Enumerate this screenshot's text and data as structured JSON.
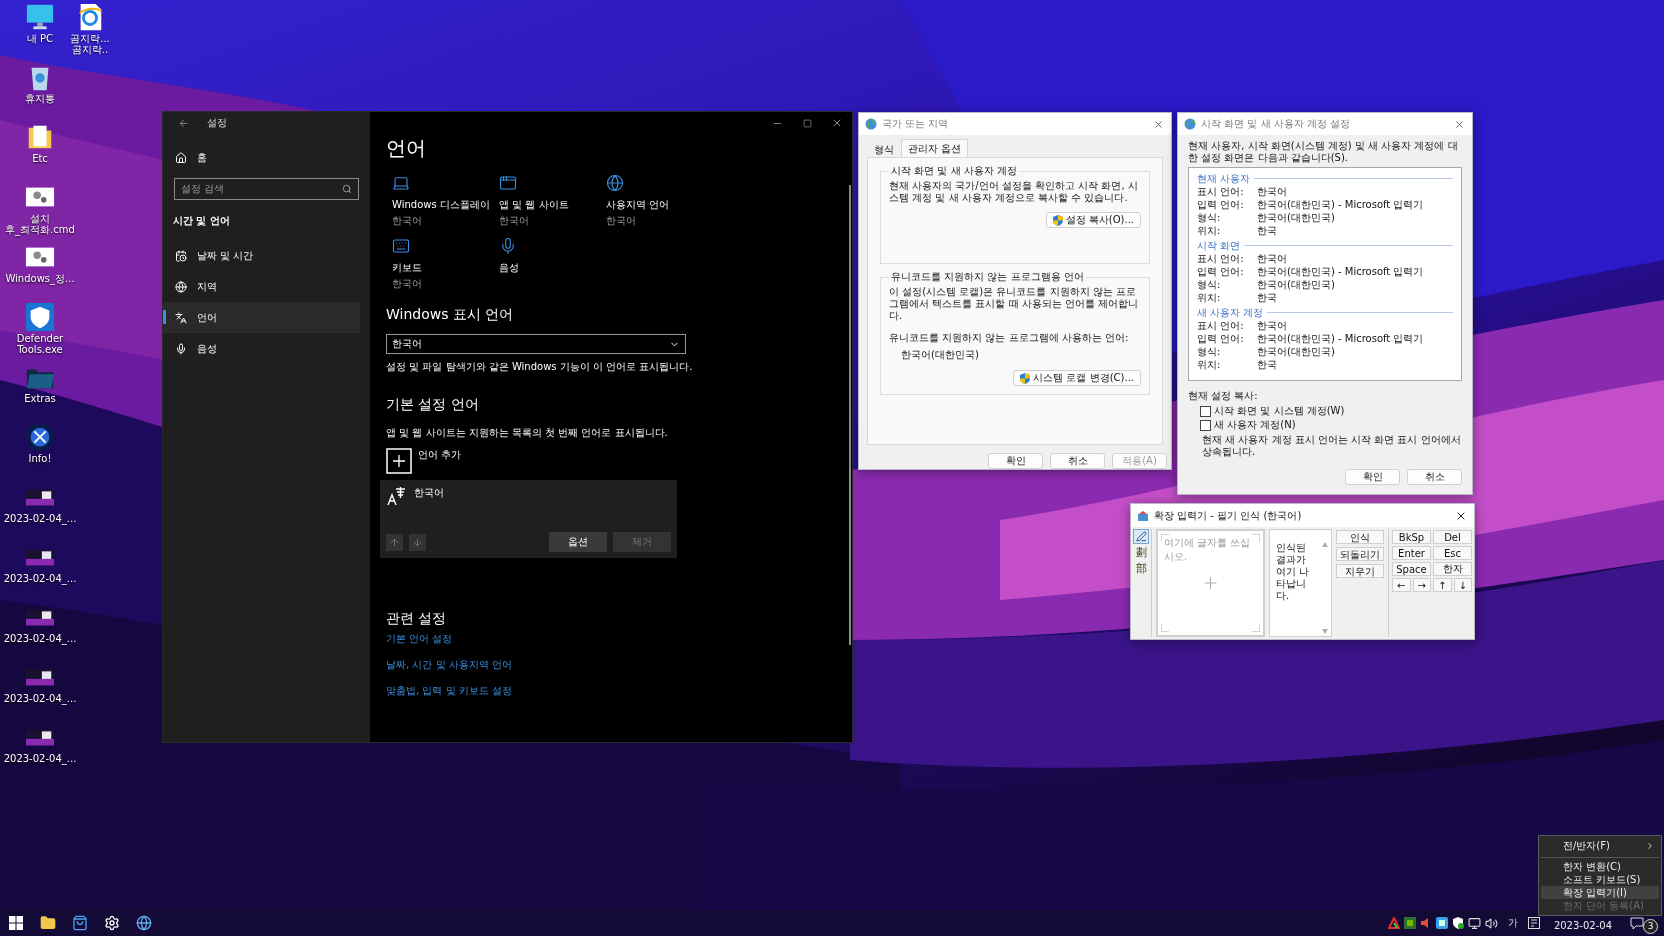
{
  "desktop_icons": {
    "column_1": [
      {
        "label": "내 PC",
        "kind": "monitor"
      },
      {
        "label": "휴지통",
        "kind": "recycle"
      },
      {
        "label": "Etc",
        "kind": "folder"
      },
      {
        "label": "설치\n후_최적화.cmd",
        "kind": "script"
      },
      {
        "label": "Windows_정...",
        "kind": "script"
      },
      {
        "label": "Defender\nTools.exe",
        "kind": "shield"
      },
      {
        "label": "Extras",
        "kind": "darkfolder"
      },
      {
        "label": "Info!",
        "kind": "orb"
      },
      {
        "label": "2023-02-04_...",
        "kind": "screenshot"
      },
      {
        "label": "2023-02-04_...",
        "kind": "screenshot"
      },
      {
        "label": "2023-02-04_...",
        "kind": "screenshot"
      },
      {
        "label": "2023-02-04_...",
        "kind": "screenshot"
      },
      {
        "label": "2023-02-04_...",
        "kind": "screenshot"
      }
    ],
    "column_2": [
      {
        "label": "곰지락...\n곰지락..",
        "kind": "browser"
      }
    ]
  },
  "settings_window": {
    "title": "설정",
    "home": "홈",
    "search": {
      "placeholder": "설정 검색"
    },
    "section": "시간 및 언어",
    "sidebar_items": [
      {
        "label": "날짜 및 시간",
        "kind": "calendar",
        "selected": false
      },
      {
        "label": "지역",
        "kind": "globe",
        "selected": false
      },
      {
        "label": "언어",
        "kind": "language",
        "selected": true
      },
      {
        "label": "음성",
        "kind": "mic",
        "selected": false
      }
    ],
    "heading": "언어",
    "tiles": [
      {
        "label": "Windows 디스플레이",
        "sub": "한국어",
        "kind": "laptop"
      },
      {
        "label": "앱 및 웹 사이트",
        "sub": "한국어",
        "kind": "window"
      },
      {
        "label": "사용지역 언어",
        "sub": "한국어",
        "kind": "globe"
      },
      {
        "label": "키보드",
        "sub": "한국어",
        "kind": "keyboard"
      },
      {
        "label": "음성",
        "kind": "mic"
      }
    ],
    "display_language": {
      "heading": "Windows 표시 언어",
      "value": "한국어",
      "description": "설정 및 파일 탐색기와 같은 Windows 기능이 이 언어로 표시됩니다."
    },
    "preferred_languages": {
      "heading": "기본 설정 언어",
      "description": "앱 및 웹 사이트는 지원하는 목록의 첫 번째 언어로 표시됩니다.",
      "add_label": "언어 추가",
      "languages": [
        {
          "name": "한국어",
          "move_up_disabled": true,
          "move_down_disabled": true,
          "buttons": [
            {
              "label": "옵션",
              "disabled": false
            },
            {
              "label": "제거",
              "disabled": true
            }
          ]
        }
      ]
    },
    "related": {
      "heading": "관련 설정",
      "links": [
        "기본 언어 설정",
        "날짜, 시간 및 사용지역 언어",
        "맞춤법, 입력 및 키보드 설정"
      ]
    }
  },
  "region_dialog": {
    "title": "국가 또는 지역",
    "tabs": [
      {
        "label": "형식",
        "selected": false
      },
      {
        "label": "관리자 옵션",
        "selected": true
      }
    ],
    "groups": [
      {
        "title": "시작 화면 및 새 사용자 계정",
        "description": "현재 사용자의 국가/언어 설정을 확인하고 시작 화면, 시스템 계정 및 새 사용자 계정으로 복사할 수 있습니다.",
        "button": "설정 복사(O)..."
      },
      {
        "title": "유니코드를 지원하지 않는 프로그램용 언어",
        "description": "이 설정(시스템 로캘)은 유니코드를 지원하지 않는 프로그램에서 텍스트를 표시할 때 사용되는 언어를 제어합니다.",
        "detail_label": "유니코드를 지원하지 않는 프로그램에 사용하는 언어:",
        "detail_value": "한국어(대한민국)",
        "button": "시스템 로캘 변경(C)..."
      }
    ],
    "buttons": [
      {
        "label": "확인",
        "disabled": false
      },
      {
        "label": "취소",
        "disabled": false
      },
      {
        "label": "적용(A)",
        "disabled": true
      }
    ]
  },
  "welcome_dialog": {
    "title": "시작 화면 및 새 사용자 계정 설정",
    "intro": "현재 사용자, 시작 화면(시스템 계정) 및 새 사용자 계정에 대한 설정 화면은 다음과 같습니다(S).",
    "sections": [
      {
        "title": "현재 사용자",
        "rows": [
          {
            "label": "표시 언어:",
            "value": "한국어"
          },
          {
            "label": "입력 언어:",
            "value": "한국어(대한민국) - Microsoft 입력기"
          },
          {
            "label": "형식:",
            "value": "한국어(대한민국)"
          },
          {
            "label": "위치:",
            "value": "한국"
          }
        ]
      },
      {
        "title": "시작 화면",
        "rows": [
          {
            "label": "표시 언어:",
            "value": "한국어"
          },
          {
            "label": "입력 언어:",
            "value": "한국어(대한민국) - Microsoft 입력기"
          },
          {
            "label": "형식:",
            "value": "한국어(대한민국)"
          },
          {
            "label": "위치:",
            "value": "한국"
          }
        ]
      },
      {
        "title": "새 사용자 계정",
        "rows": [
          {
            "label": "표시 언어:",
            "value": "한국어"
          },
          {
            "label": "입력 언어:",
            "value": "한국어(대한민국) - Microsoft 입력기"
          },
          {
            "label": "형식:",
            "value": "한국어(대한민국)"
          },
          {
            "label": "위치:",
            "value": "한국"
          }
        ]
      }
    ],
    "copy_label": "현재 설정 복사:",
    "checkboxes": [
      {
        "label": "시작 화면 및 시스템 계정(W)",
        "checked": false
      },
      {
        "label": "새 사용자 계정(N)",
        "checked": false
      }
    ],
    "note": "현재 새 사용자 계정 표시 언어는 시작 화면 표시 언어에서 상속됩니다.",
    "buttons": [
      "확인",
      "취소"
    ]
  },
  "ime_pad": {
    "title": "확장 입력기 - 필기 인식 (한국어)",
    "tools": [
      {
        "kind": "pen",
        "selected": true
      },
      {
        "kind": "glyph",
        "label": "劃",
        "selected": false
      },
      {
        "kind": "glyph",
        "label": "部",
        "selected": false
      }
    ],
    "placeholder": "여기에 글자를 쓰십시오.",
    "result_text": "인식된 결과가 여기 나타납니다.",
    "actions": [
      "인식",
      "되돌리기",
      "지우기"
    ],
    "keys": [
      {
        "label": "BkSp",
        "kind": "wide"
      },
      {
        "label": "Del",
        "kind": "wide"
      },
      {
        "label": "Enter",
        "kind": "wide"
      },
      {
        "label": "Esc",
        "kind": "wide"
      },
      {
        "label": "Space",
        "kind": "wide"
      },
      {
        "label": "한자",
        "kind": "wide"
      },
      {
        "label": "←",
        "kind": "arrow"
      },
      {
        "label": "→",
        "kind": "arrow"
      },
      {
        "label": "↑",
        "kind": "arrow"
      },
      {
        "label": "↓",
        "kind": "arrow"
      }
    ]
  },
  "context_menu": {
    "items": [
      {
        "label": "전/반자(F)",
        "submenu": true,
        "divider_after": true,
        "selected": false,
        "disabled": false
      },
      {
        "label": "한자 변환(C)",
        "submenu": false,
        "divider_after": false,
        "selected": false,
        "disabled": false
      },
      {
        "label": "소프트 키보드(S)",
        "submenu": false,
        "divider_after": false,
        "selected": false,
        "disabled": false
      },
      {
        "label": "확장 입력기(I)",
        "submenu": false,
        "divider_after": false,
        "selected": true,
        "disabled": false
      },
      {
        "label": "한자 단어 등록(A)",
        "submenu": false,
        "divider_after": false,
        "selected": false,
        "disabled": true
      }
    ]
  },
  "taskbar": {
    "ime_indicator": "가",
    "date": "2023-02-04",
    "notification_count": "3"
  }
}
